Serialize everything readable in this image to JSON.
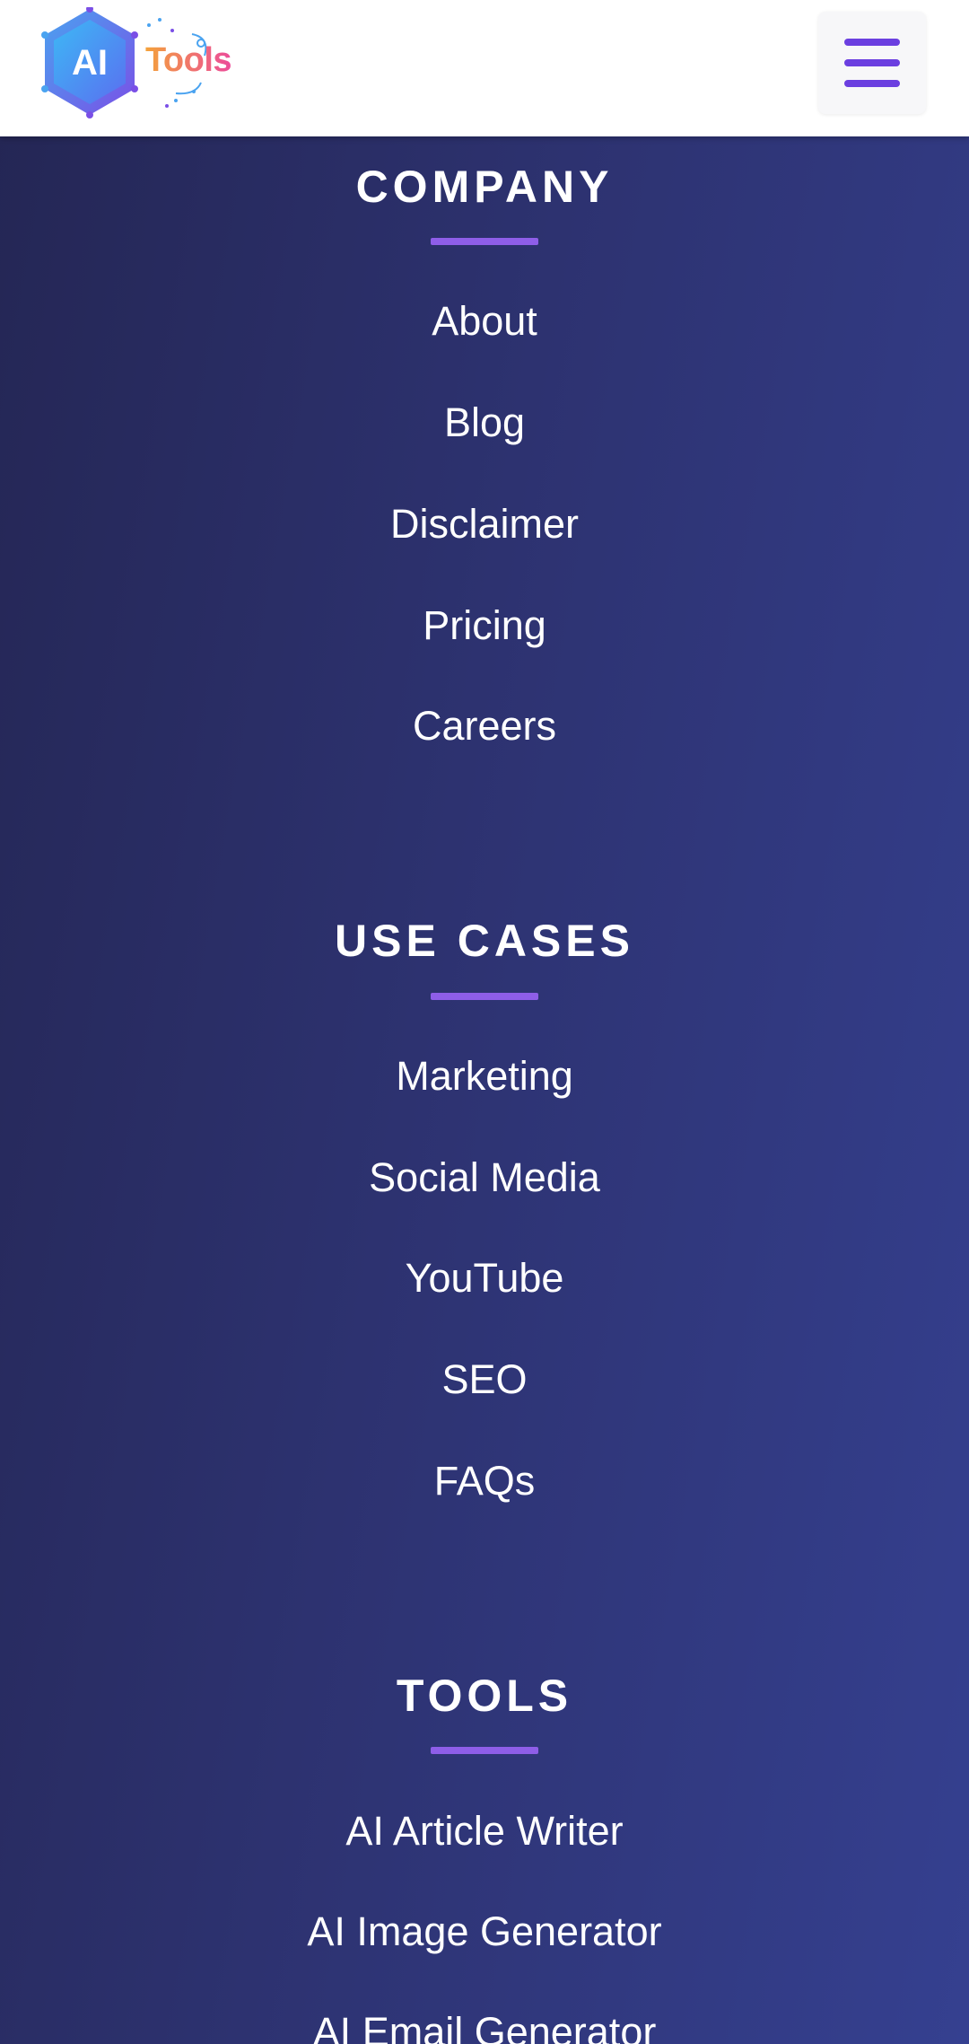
{
  "header": {
    "logo_badge": "AI",
    "logo_word": "Tools",
    "menu_icon": "hamburger-menu-icon"
  },
  "sections": [
    {
      "title": "COMPANY",
      "links": [
        "About",
        "Blog",
        "Disclaimer",
        "Pricing",
        "Careers"
      ]
    },
    {
      "title": "USE CASES",
      "links": [
        "Marketing",
        "Social Media",
        "YouTube",
        "SEO",
        "FAQs"
      ]
    },
    {
      "title": "TOOLS",
      "links": [
        "AI Article Writer",
        "AI Image Generator",
        "AI Email Generator"
      ]
    }
  ],
  "colors": {
    "accent": "#8e5ee8",
    "menu_icon": "#6b3fe0",
    "background_start": "#242654",
    "background_end": "#354090"
  }
}
